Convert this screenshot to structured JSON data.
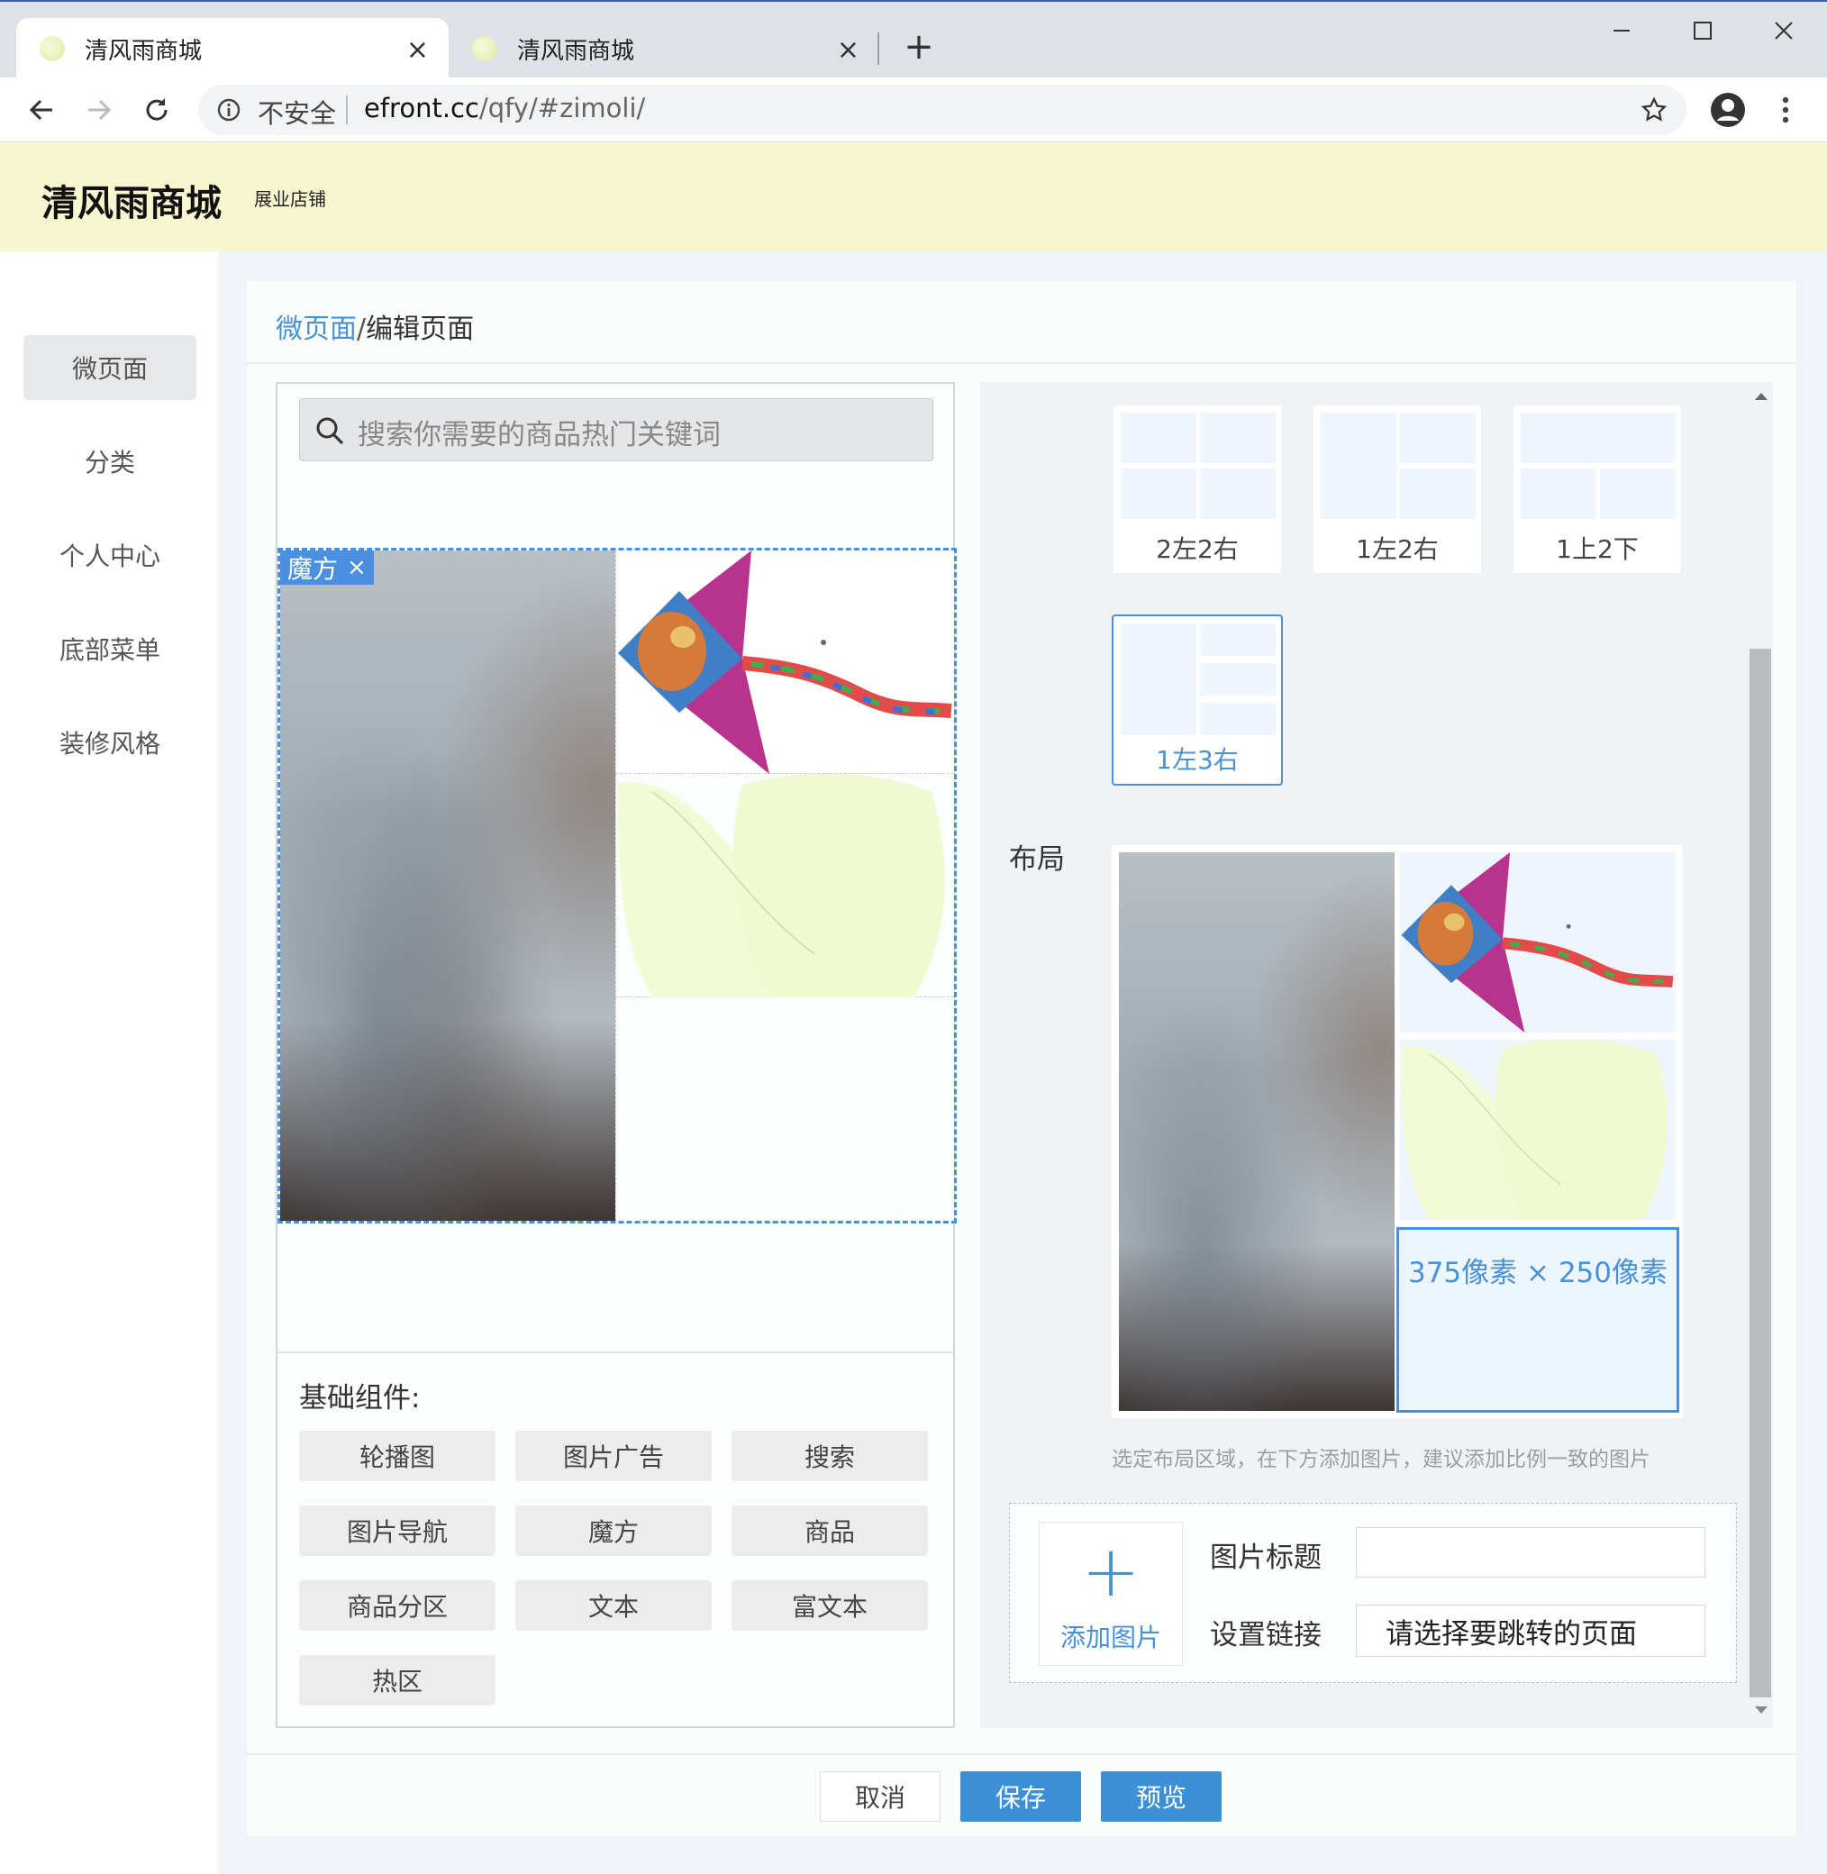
{
  "browser": {
    "tabs": [
      {
        "title": "清风雨商城",
        "close": "×"
      },
      {
        "title": "清风雨商城",
        "close": "×"
      }
    ],
    "new_tab": "+",
    "security_label": "不安全",
    "url_host": "efront.cc",
    "url_path": "/qfy/#zimoli/"
  },
  "shop": {
    "name": "清风雨商城",
    "tagline": "展业店铺"
  },
  "sidebar": {
    "items": [
      {
        "label": "微页面"
      },
      {
        "label": "分类"
      },
      {
        "label": "个人中心"
      },
      {
        "label": "底部菜单"
      },
      {
        "label": "装修风格"
      }
    ]
  },
  "breadcrumb": {
    "parent": "微页面",
    "separator": "/",
    "current": "编辑页面"
  },
  "preview": {
    "search_placeholder": "搜索你需要的商品热门关键词",
    "component_tag": "魔方",
    "component_tag_close": "×"
  },
  "components": {
    "title": "基础组件:",
    "items": [
      "轮播图",
      "图片广告",
      "搜索",
      "图片导航",
      "魔方",
      "商品",
      "商品分区",
      "文本",
      "富文本",
      "热区"
    ]
  },
  "layouts": {
    "options": [
      {
        "label": "2左2右",
        "selected": false
      },
      {
        "label": "1左2右",
        "selected": false
      },
      {
        "label": "1上2下",
        "selected": false
      },
      {
        "label": "1左3右",
        "selected": true
      }
    ]
  },
  "layout_editor": {
    "label": "布局",
    "selected_cell_size": "375像素 × 250像素",
    "hint": "选定布局区域，在下方添加图片，建议添加比例一致的图片"
  },
  "image_form": {
    "add_image_icon": "+",
    "add_image_label": "添加图片",
    "title_label": "图片标题",
    "title_value": "",
    "link_label": "设置链接",
    "link_value": "请选择要跳转的页面"
  },
  "footer": {
    "cancel": "取消",
    "save": "保存",
    "preview": "预览"
  },
  "colors": {
    "accent": "#3d8fd6",
    "link": "#4a90d9",
    "header_bg": "#f8f6d0"
  }
}
